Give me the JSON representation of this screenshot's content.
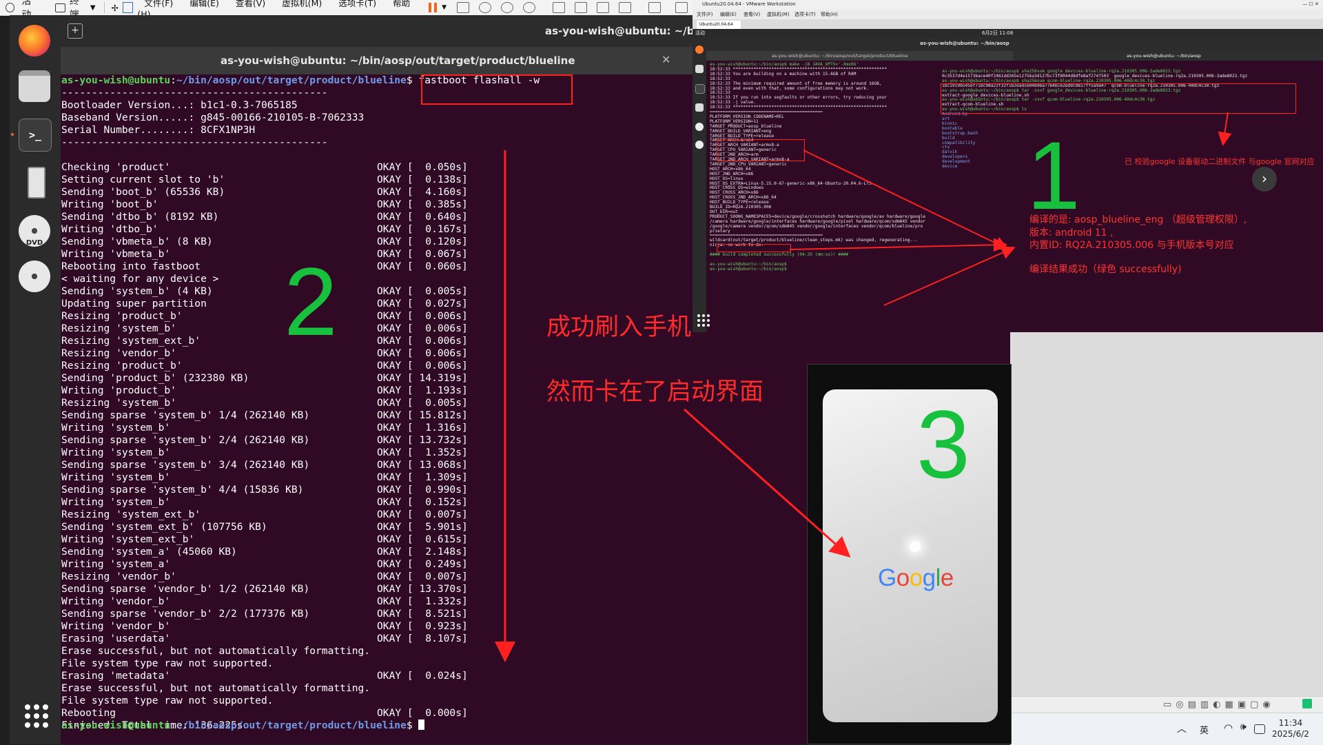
{
  "topbar": {
    "activities": "活动",
    "app": "终端",
    "menus": [
      "文件(F)",
      "编辑(E)",
      "查看(V)",
      "虚拟机(M)",
      "选项卡(T)",
      "帮助(H)"
    ]
  },
  "terminal": {
    "header_title": "as-you-wish@ubuntu: ~/bin/aosp",
    "tab_title": "as-you-wish@ubuntu: ~/bin/aosp/out/target/product/blueline",
    "prompt_user": "as-you-wish@ubuntu",
    "prompt_path": "~/bin/aosp/out/target/product/blueline",
    "command": " fastboot flashall -w",
    "lines": [
      {
        "t": "--------------------------------------------",
        "s": ""
      },
      {
        "t": "Bootloader Version...: b1c1-0.3-7065185",
        "s": ""
      },
      {
        "t": "Baseband Version.....: g845-00166-210105-B-7062333",
        "s": ""
      },
      {
        "t": "Serial Number........: 8CFX1NP3H",
        "s": ""
      },
      {
        "t": "--------------------------------------------",
        "s": ""
      },
      {
        "t": "",
        "s": ""
      },
      {
        "t": "Checking 'product'",
        "s": "OKAY [  0.050s]"
      },
      {
        "t": "Setting current slot to 'b'",
        "s": "OKAY [  0.138s]"
      },
      {
        "t": "Sending 'boot_b' (65536 KB)",
        "s": "OKAY [  4.160s]"
      },
      {
        "t": "Writing 'boot_b'",
        "s": "OKAY [  0.385s]"
      },
      {
        "t": "Sending 'dtbo_b' (8192 KB)",
        "s": "OKAY [  0.640s]"
      },
      {
        "t": "Writing 'dtbo_b'",
        "s": "OKAY [  0.167s]"
      },
      {
        "t": "Sending 'vbmeta_b' (8 KB)",
        "s": "OKAY [  0.120s]"
      },
      {
        "t": "Writing 'vbmeta_b'",
        "s": "OKAY [  0.067s]"
      },
      {
        "t": "Rebooting into fastboot",
        "s": "OKAY [  0.060s]"
      },
      {
        "t": "< waiting for any device >",
        "s": ""
      },
      {
        "t": "Sending 'system_b' (4 KB)",
        "s": "OKAY [  0.005s]"
      },
      {
        "t": "Updating super partition",
        "s": "OKAY [  0.027s]"
      },
      {
        "t": "Resizing 'product_b'",
        "s": "OKAY [  0.006s]"
      },
      {
        "t": "Resizing 'system_b'",
        "s": "OKAY [  0.006s]"
      },
      {
        "t": "Resizing 'system_ext_b'",
        "s": "OKAY [  0.006s]"
      },
      {
        "t": "Resizing 'vendor_b'",
        "s": "OKAY [  0.006s]"
      },
      {
        "t": "Resizing 'product_b'",
        "s": "OKAY [  0.006s]"
      },
      {
        "t": "Sending 'product_b' (232380 KB)",
        "s": "OKAY [ 14.319s]"
      },
      {
        "t": "Writing 'product_b'",
        "s": "OKAY [  1.193s]"
      },
      {
        "t": "Resizing 'system_b'",
        "s": "OKAY [  0.005s]"
      },
      {
        "t": "Sending sparse 'system_b' 1/4 (262140 KB)",
        "s": "OKAY [ 15.812s]"
      },
      {
        "t": "Writing 'system_b'",
        "s": "OKAY [  1.316s]"
      },
      {
        "t": "Sending sparse 'system_b' 2/4 (262140 KB)",
        "s": "OKAY [ 13.732s]"
      },
      {
        "t": "Writing 'system_b'",
        "s": "OKAY [  1.352s]"
      },
      {
        "t": "Sending sparse 'system_b' 3/4 (262140 KB)",
        "s": "OKAY [ 13.068s]"
      },
      {
        "t": "Writing 'system_b'",
        "s": "OKAY [  1.309s]"
      },
      {
        "t": "Sending sparse 'system_b' 4/4 (15836 KB)",
        "s": "OKAY [  0.990s]"
      },
      {
        "t": "Writing 'system_b'",
        "s": "OKAY [  0.152s]"
      },
      {
        "t": "Resizing 'system_ext_b'",
        "s": "OKAY [  0.007s]"
      },
      {
        "t": "Sending 'system_ext_b' (107756 KB)",
        "s": "OKAY [  5.901s]"
      },
      {
        "t": "Writing 'system_ext_b'",
        "s": "OKAY [  0.615s]"
      },
      {
        "t": "Sending 'system_a' (45060 KB)",
        "s": "OKAY [  2.148s]"
      },
      {
        "t": "Writing 'system_a'",
        "s": "OKAY [  0.249s]"
      },
      {
        "t": "Resizing 'vendor_b'",
        "s": "OKAY [  0.007s]"
      },
      {
        "t": "Sending sparse 'vendor_b' 1/2 (262140 KB)",
        "s": "OKAY [ 13.370s]"
      },
      {
        "t": "Writing 'vendor_b'",
        "s": "OKAY [  1.332s]"
      },
      {
        "t": "Sending sparse 'vendor_b' 2/2 (177376 KB)",
        "s": "OKAY [  8.521s]"
      },
      {
        "t": "Writing 'vendor_b'",
        "s": "OKAY [  0.923s]"
      },
      {
        "t": "Erasing 'userdata'",
        "s": "OKAY [  8.107s]"
      },
      {
        "t": "Erase successful, but not automatically formatting.",
        "s": ""
      },
      {
        "t": "File system type raw not supported.",
        "s": ""
      },
      {
        "t": "Erasing 'metadata'",
        "s": "OKAY [  0.024s]"
      },
      {
        "t": "Erase successful, but not automatically formatting.",
        "s": ""
      },
      {
        "t": "File system type raw not supported.",
        "s": ""
      },
      {
        "t": "Rebooting",
        "s": "OKAY [  0.000s]"
      },
      {
        "t": "Finished. Total time: 136.225s",
        "s": ""
      }
    ]
  },
  "vm": {
    "window_title": "Ubuntu20.04.64 - VMware Workstation",
    "menus": [
      "文件(F)",
      "编辑(E)",
      "查看(V)",
      "虚拟机(M)",
      "选项卡(T)",
      "帮助(H)"
    ],
    "tab": "Ubuntu20.04.64",
    "desktop_activities": "活动",
    "desktop_clock": "6月2日  11:08",
    "term_title": "as-you-wish@ubuntu: ~/bin/aosp",
    "tab1": "as-you-wish@ubuntu: ~/bin/aosp/out/target/product/blueline",
    "tab2": "as-you-wish@ubuntu: ~/bin/aosp",
    "left_lines": [
      {
        "t": "as-you-wish@ubuntu:~/bin/aosp$ make -j8 JAVA_OPTS='-Xmx6G'",
        "c": "g"
      },
      {
        "t": "18:52:33 ************************************************************",
        "c": ""
      },
      {
        "t": "18:52:33 You are building on a machine with 15.6GB of RAM",
        "c": ""
      },
      {
        "t": "18:52:33",
        "c": ""
      },
      {
        "t": "18:52:33 The minimum required amount of free memory is around 16GB,",
        "c": ""
      },
      {
        "t": "18:52:33 and even with that, some configurations may not work.",
        "c": ""
      },
      {
        "t": "18:52:33",
        "c": ""
      },
      {
        "t": "18:52:33 If you run into segfaults or other errors, try reducing your",
        "c": ""
      },
      {
        "t": "18:52:33 -j value.",
        "c": ""
      },
      {
        "t": "18:52:33 ************************************************************",
        "c": ""
      },
      {
        "t": "============================================",
        "c": ""
      },
      {
        "t": "PLATFORM_VERSION_CODENAME=REL",
        "c": ""
      },
      {
        "t": "PLATFORM_VERSION=11",
        "c": ""
      },
      {
        "t": "TARGET_PRODUCT=aosp_blueline",
        "c": ""
      },
      {
        "t": "TARGET_BUILD_VARIANT=eng",
        "c": ""
      },
      {
        "t": "TARGET_BUILD_TYPE=release",
        "c": ""
      },
      {
        "t": "TARGET_ARCH=arm64",
        "c": ""
      },
      {
        "t": "TARGET_ARCH_VARIANT=armv8-a",
        "c": ""
      },
      {
        "t": "TARGET_CPU_VARIANT=generic",
        "c": ""
      },
      {
        "t": "TARGET_2ND_ARCH=arm",
        "c": ""
      },
      {
        "t": "TARGET_2ND_ARCH_VARIANT=armv8-a",
        "c": ""
      },
      {
        "t": "TARGET_2ND_CPU_VARIANT=generic",
        "c": ""
      },
      {
        "t": "HOST_ARCH=x86_64",
        "c": ""
      },
      {
        "t": "HOST_2ND_ARCH=x86",
        "c": ""
      },
      {
        "t": "HOST_OS=linux",
        "c": ""
      },
      {
        "t": "HOST_OS_EXTRA=Linux-5.15.0-67-generic-x86_64-Ubuntu-20.04.6-LTS",
        "c": ""
      },
      {
        "t": "HOST_CROSS_OS=windows",
        "c": ""
      },
      {
        "t": "HOST_CROSS_ARCH=x86",
        "c": ""
      },
      {
        "t": "HOST_CROSS_2ND_ARCH=x86_64",
        "c": ""
      },
      {
        "t": "HOST_BUILD_TYPE=release",
        "c": ""
      },
      {
        "t": "BUILD_ID=RQ2A.210305.006",
        "c": ""
      },
      {
        "t": "OUT_DIR=out",
        "c": ""
      },
      {
        "t": "PRODUCT_SOONG_NAMESPACES=device/google/crosshatch hardware/google/av hardware/google",
        "c": ""
      },
      {
        "t": "/camera hardware/google/interfaces hardware/google/pixel hardware/qcom/sdm845 vendor",
        "c": ""
      },
      {
        "t": "/google/camera vendor/qcom/sdm845 vendor/google/interfaces vendor/qcom/blueline/pro",
        "c": ""
      },
      {
        "t": "prietary",
        "c": ""
      },
      {
        "t": "============================================",
        "c": ""
      },
      {
        "t": "wildcard(out/target/product/blueline/clean_steps.mk) was changed, regenerating...",
        "c": ""
      },
      {
        "t": "ninja: no work to do.",
        "c": ""
      },
      {
        "t": "",
        "c": ""
      },
      {
        "t": "#### build completed successfully (04:35 (mm:ss)) ####",
        "c": "g"
      },
      {
        "t": "",
        "c": ""
      },
      {
        "t": "as-you-wish@ubuntu:~/bin/aosp$",
        "c": "g"
      },
      {
        "t": "as-you-wish@ubuntu:~/bin/aosp$",
        "c": "g"
      }
    ],
    "right_lines": [
      {
        "t": "as-you-wish@ubuntu:~/bin/aosp$ sha256sum google_devices-blueline-rq2a.210305.006-3ade8023.tgz",
        "c": "g"
      },
      {
        "t": "0c3537d4e1573bace40f2461dd265e12756a3d127bc73f8044d8dfe8af2747503  google_devices-blueline-rq2a.210305.006-3ade8023.tgz",
        "c": ""
      },
      {
        "t": "as-you-wish@ubuntu:~/bin/aosp$ sha256sum qcom-blueline-rq2a.210305.006-40dc4c30.tgz",
        "c": "g"
      },
      {
        "t": "1bc1919b545ef718c98a22f32f1b2eadce04b9ba7764bce2ed9cd817ff5a9a47  qcom-blueline-rq2a.210305.006-40dc4c30.tgz",
        "c": ""
      },
      {
        "t": "as-you-wish@ubuntu:~/bin/aosp$ tar -zxvf google_devices-blueline-rq2a.210305.006-3ade8023.tgz",
        "c": "g"
      },
      {
        "t": "extract-google_devices-blueline.sh",
        "c": ""
      },
      {
        "t": "as-you-wish@ubuntu:~/bin/aosp$ tar -zxvf qcom-blueline-rq2a.210305.006-40dc4c30.tgz",
        "c": "g"
      },
      {
        "t": "extract-qcom-blueline.sh",
        "c": ""
      },
      {
        "t": "as-you-wish@ubuntu:~/bin/aosp$ ls",
        "c": "g"
      },
      {
        "t": "Android.bp",
        "c": "b"
      },
      {
        "t": "art",
        "c": "b"
      },
      {
        "t": "bionic",
        "c": "b"
      },
      {
        "t": "bootable",
        "c": "b"
      },
      {
        "t": "bootstrap.bash",
        "c": "b"
      },
      {
        "t": "build",
        "c": "b"
      },
      {
        "t": "compatibility",
        "c": "b"
      },
      {
        "t": "cts",
        "c": "b"
      },
      {
        "t": "dalvik",
        "c": "b"
      },
      {
        "t": "developers",
        "c": "b"
      },
      {
        "t": "development",
        "c": "b"
      },
      {
        "t": "device",
        "c": "b"
      }
    ]
  },
  "annotations": {
    "num1": "1",
    "num2": "2",
    "num3": "3",
    "success_flash": "成功刷入手机",
    "stuck_boot": "然而卡在了启动界面",
    "verified_note": "已 校验google 设备驱动二进制文件  与google 官网对应",
    "compiled": "编译的是:   aosp_blueline_eng （超级管理权限）,",
    "version": "版本:  android 11  ,",
    "internal_id": "内置ID:    RQ2A.210305.006  与手机版本号对应",
    "compile_result": "编译结果成功（绿色  successfully)"
  },
  "phone": {
    "logo_letters": [
      "G",
      "o",
      "o",
      "g",
      "l",
      "e"
    ],
    "logo_colors": [
      "#4285F4",
      "#EA4335",
      "#FBBC05",
      "#4285F4",
      "#34A853",
      "#EA4335"
    ]
  },
  "taskbar": {
    "ime": "英",
    "time": "11:34",
    "date": "2025/6/2"
  },
  "colors": {
    "terminal_bg": "#300a24",
    "prompt_user": "#5ad35a",
    "prompt_path": "#6f9bea",
    "annotation_red": "#ff2a2a",
    "annotation_green": "#17c13e"
  }
}
